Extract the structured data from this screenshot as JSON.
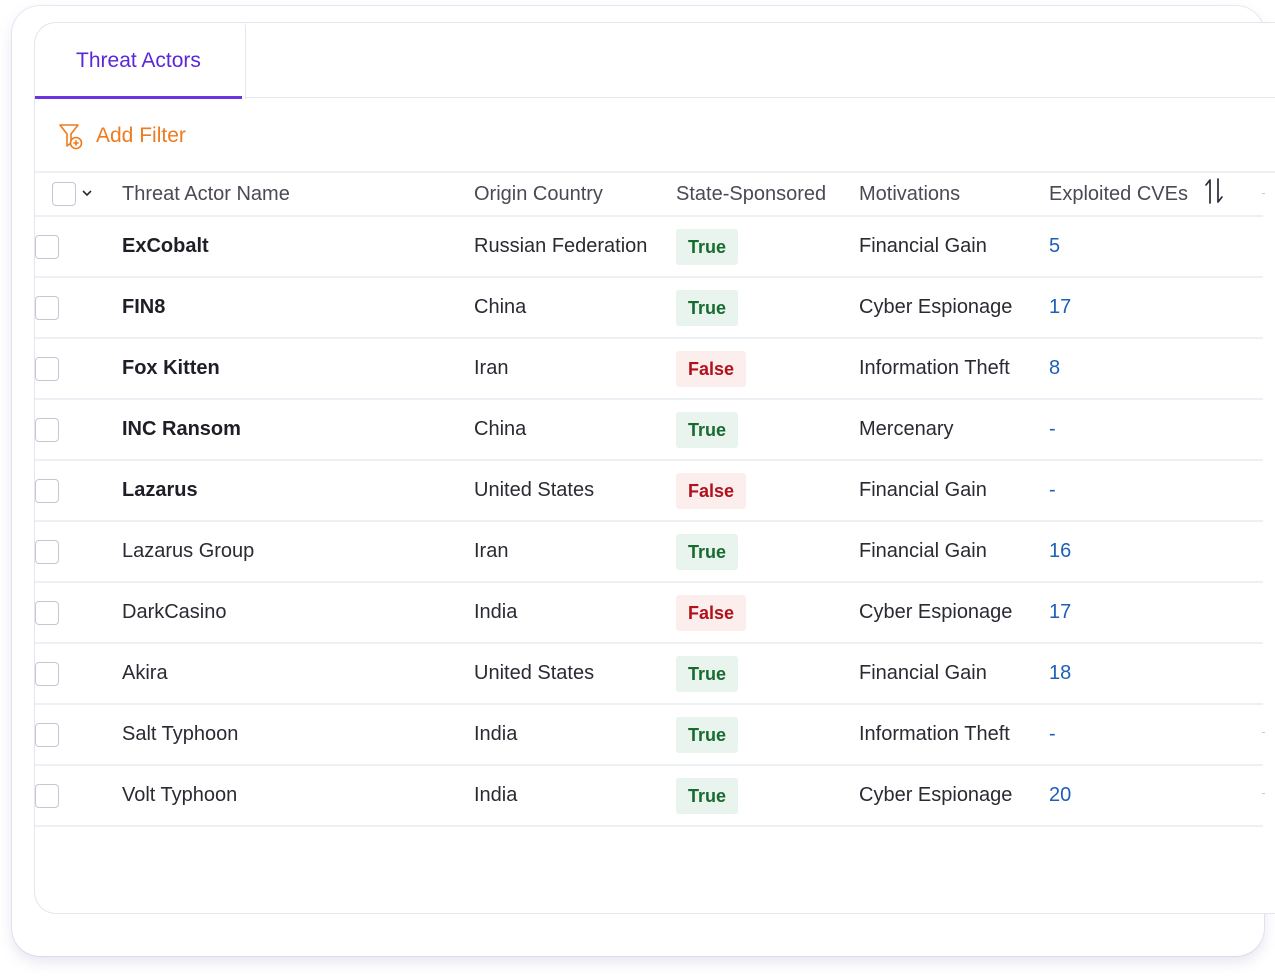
{
  "tabs": [
    {
      "label": "Threat Actors",
      "active": true
    }
  ],
  "filter": {
    "label": "Add Filter",
    "icon": "filter-add-icon",
    "color": "#ee7c1e"
  },
  "table": {
    "columns": [
      {
        "key": "name",
        "label": "Threat Actor Name"
      },
      {
        "key": "country",
        "label": "Origin Country"
      },
      {
        "key": "state",
        "label": "State-Sponsored"
      },
      {
        "key": "motivation",
        "label": "Motivations"
      },
      {
        "key": "cves",
        "label": "Exploited CVEs",
        "sortable": true
      }
    ],
    "rows": [
      {
        "name": "ExCobalt",
        "bold": true,
        "country": "Russian Federation",
        "state": "True",
        "motivation": "Financial Gain",
        "cves": "5"
      },
      {
        "name": "FIN8",
        "bold": true,
        "country": "China",
        "state": "True",
        "motivation": "Cyber Espionage",
        "cves": "17"
      },
      {
        "name": "Fox Kitten",
        "bold": true,
        "country": "Iran",
        "state": "False",
        "motivation": "Information Theft",
        "cves": "8"
      },
      {
        "name": "INC Ransom",
        "bold": true,
        "country": "China",
        "state": "True",
        "motivation": "Mercenary",
        "cves": "-"
      },
      {
        "name": "Lazarus",
        "bold": true,
        "country": "United States",
        "state": "False",
        "motivation": "Financial Gain",
        "cves": "-"
      },
      {
        "name": "Lazarus Group",
        "bold": false,
        "country": "Iran",
        "state": "True",
        "motivation": "Financial Gain",
        "cves": "16"
      },
      {
        "name": "DarkCasino",
        "bold": false,
        "country": "India",
        "state": "False",
        "motivation": "Cyber Espionage",
        "cves": "17"
      },
      {
        "name": "Akira",
        "bold": false,
        "country": "United States",
        "state": "True",
        "motivation": "Financial Gain",
        "cves": "18"
      },
      {
        "name": "Salt Typhoon",
        "bold": false,
        "country": "India",
        "state": "True",
        "motivation": "Information Theft",
        "cves": "-"
      },
      {
        "name": "Volt Typhoon",
        "bold": false,
        "country": "India",
        "state": "True",
        "motivation": "Cyber Espionage",
        "cves": "20"
      }
    ]
  },
  "colors": {
    "accent": "#5a28d9",
    "filter": "#ee7c1e",
    "link": "#1e5fb8",
    "true_text": "#176b2f",
    "true_bg": "#eaf4ee",
    "false_text": "#b0121c",
    "false_bg": "#fdeeee"
  }
}
